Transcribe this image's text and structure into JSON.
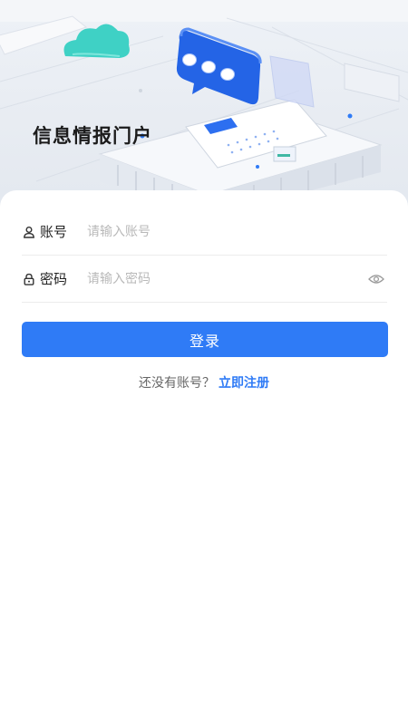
{
  "hero": {
    "title": "信息情报门户",
    "illustration": "cloud-chat-building-illustration"
  },
  "form": {
    "account": {
      "icon": "user-icon",
      "label": "账号",
      "placeholder": "请输入账号",
      "value": ""
    },
    "password": {
      "icon": "lock-icon",
      "label": "密码",
      "placeholder": "请输入密码",
      "value": "",
      "toggle_icon": "eye-icon"
    },
    "submit_label": "登录"
  },
  "register": {
    "prompt": "还没有账号？",
    "link": "立即注册"
  },
  "colors": {
    "primary": "#2f7bf6",
    "cloud": "#3fd1c5",
    "chat_bubble": "#2464e6",
    "placeholder": "#b9b9b9"
  }
}
